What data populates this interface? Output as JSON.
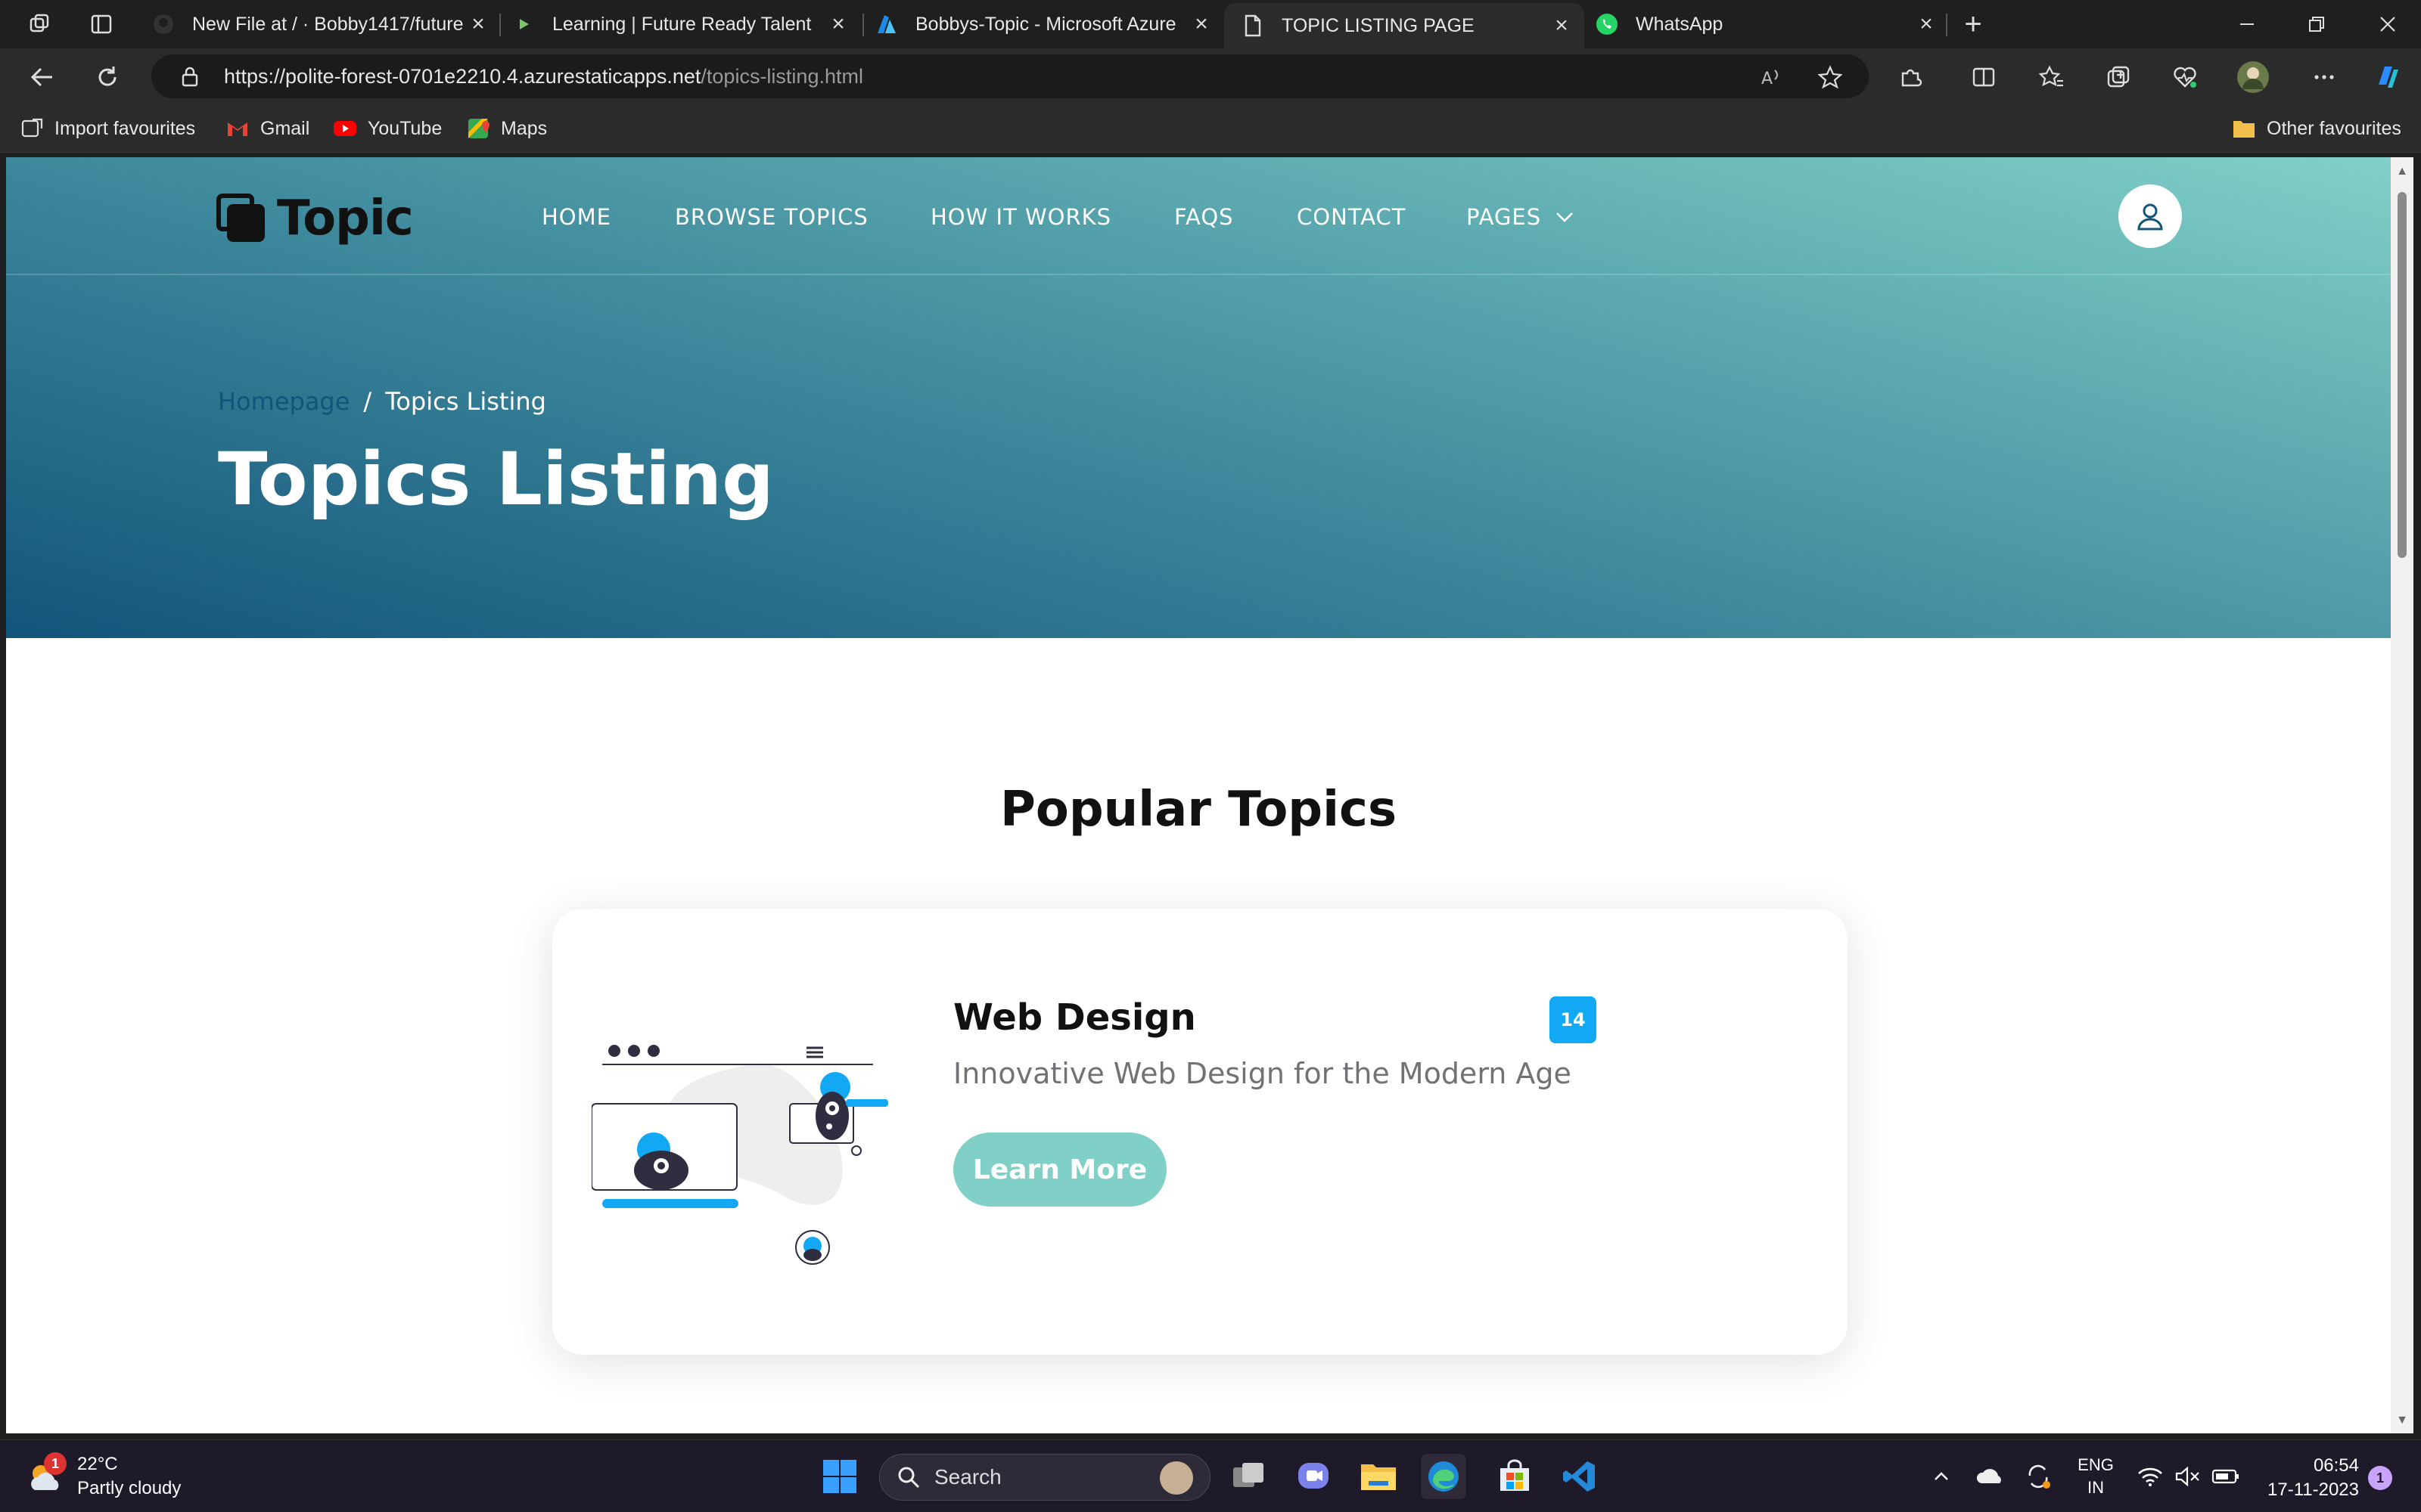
{
  "browser": {
    "tabs": [
      {
        "title": "New File at / · Bobby1417/future",
        "icon": "github-icon"
      },
      {
        "title": "Learning | Future Ready Talent",
        "icon": "play-icon"
      },
      {
        "title": "Bobbys-Topic - Microsoft Azure",
        "icon": "azure-icon"
      },
      {
        "title": "TOPIC LISTING PAGE",
        "icon": "page-icon",
        "active": true
      },
      {
        "title": "WhatsApp",
        "icon": "whatsapp-icon"
      }
    ],
    "url_host": "https://polite-forest-0701e2210.4.azurestaticapps.net",
    "url_path": "/topics-listing.html",
    "favourites": [
      {
        "label": "Import favourites",
        "icon": "import-icon"
      },
      {
        "label": "Gmail",
        "icon": "gmail-icon"
      },
      {
        "label": "YouTube",
        "icon": "youtube-icon"
      },
      {
        "label": "Maps",
        "icon": "maps-icon"
      }
    ],
    "other_favourites": "Other favourites"
  },
  "site": {
    "brand": "Topic",
    "nav": [
      "HOME",
      "BROWSE TOPICS",
      "HOW IT WORKS",
      "FAQS",
      "CONTACT",
      "PAGES"
    ],
    "breadcrumb": {
      "home": "Homepage",
      "separator": "/",
      "current": "Topics Listing"
    },
    "hero_title": "Topics Listing",
    "section_title": "Popular Topics",
    "card": {
      "title": "Web Design",
      "badge": "14",
      "description": "Innovative Web Design for the Modern Age",
      "button": "Learn More"
    },
    "colors": {
      "hero_start": "#13547a",
      "hero_end": "#80d0c7",
      "badge": "#13a8f3",
      "button": "#80d0c7"
    }
  },
  "taskbar": {
    "weather_temp": "22°C",
    "weather_desc": "Partly cloudy",
    "weather_badge": "1",
    "search_label": "Search",
    "lang_1": "ENG",
    "lang_2": "IN",
    "time": "06:54",
    "date": "17-11-2023",
    "notifications": "1"
  }
}
